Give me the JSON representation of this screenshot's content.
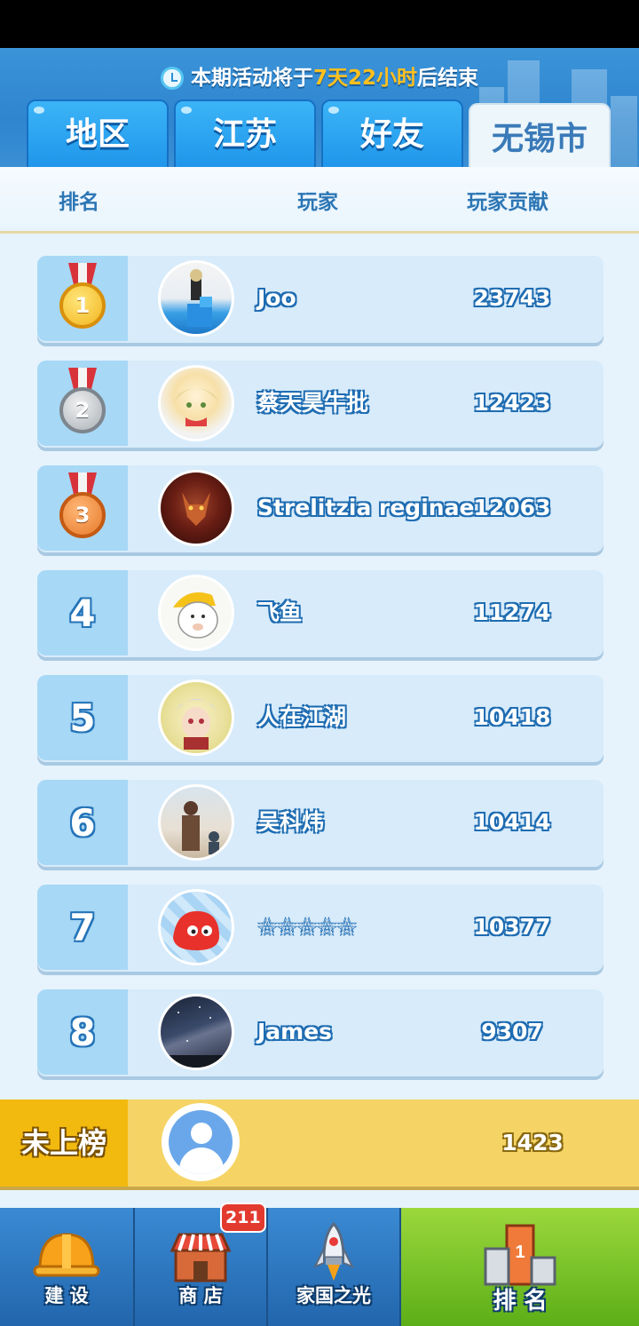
{
  "timer": {
    "prefix": "本期活动将于",
    "highlight": "7天22小时",
    "suffix": "后结束"
  },
  "tabs": [
    {
      "label": "地区",
      "active": false
    },
    {
      "label": "江苏",
      "active": false
    },
    {
      "label": "好友",
      "active": false
    },
    {
      "label": "无锡市",
      "active": true
    }
  ],
  "columns": {
    "rank": "排名",
    "player": "玩家",
    "contribution": "玩家贡献"
  },
  "rows": [
    {
      "rank": "1",
      "medal": "gold",
      "name": "Joo",
      "score": "23743",
      "avatar": "character-avatar"
    },
    {
      "rank": "2",
      "medal": "silver",
      "name": "蔡天昊牛批",
      "score": "12423",
      "avatar": "anime-girl-avatar"
    },
    {
      "rank": "3",
      "medal": "bronze",
      "name": "Strelitzia reginae",
      "score": "12063",
      "avatar": "warrior-avatar"
    },
    {
      "rank": "4",
      "medal": "",
      "name": "飞鱼",
      "score": "11274",
      "avatar": "cartoon-cat-avatar"
    },
    {
      "rank": "5",
      "medal": "",
      "name": "人在江湖",
      "score": "10418",
      "avatar": "anime-boy-avatar"
    },
    {
      "rank": "6",
      "medal": "",
      "name": "吴科炜",
      "score": "10414",
      "avatar": "illustration-avatar"
    },
    {
      "rank": "7",
      "medal": "",
      "name": "☆☆☆☆☆",
      "score": "10377",
      "avatar": "red-cartoon-avatar"
    },
    {
      "rank": "8",
      "medal": "",
      "name": "James",
      "score": "9307",
      "avatar": "night-sky-avatar"
    }
  ],
  "mine": {
    "tag": "未上榜",
    "score": "1423"
  },
  "nav": [
    {
      "label": "建 设",
      "icon": "hard-hat-icon",
      "badge": ""
    },
    {
      "label": "商 店",
      "icon": "shop-icon",
      "badge": "211"
    },
    {
      "label": "家国之光",
      "icon": "rocket-icon",
      "badge": ""
    },
    {
      "label": "排 名",
      "icon": "podium-icon",
      "badge": "",
      "active": true
    }
  ],
  "colors": {
    "accent_blue": "#1f96ea",
    "gold": "#f2b90f",
    "nav_active": "#7cc52a"
  }
}
